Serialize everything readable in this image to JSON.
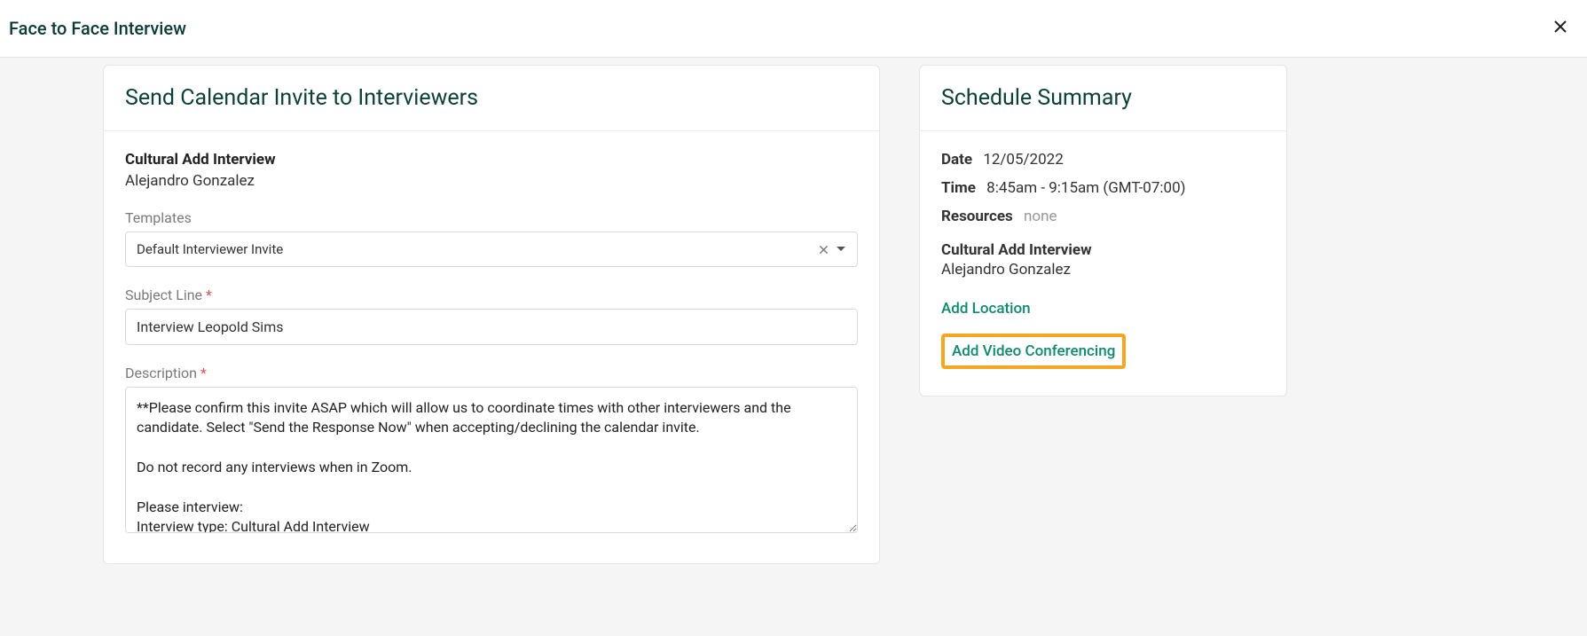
{
  "topbar": {
    "title": "Face to Face Interview"
  },
  "left": {
    "header": "Send Calendar Invite to Interviewers",
    "interview_name": "Cultural Add Interview",
    "candidate": "Alejandro Gonzalez",
    "templates_label": "Templates",
    "template_selected": "Default Interviewer Invite",
    "subject_label": "Subject Line",
    "subject_value": "Interview Leopold Sims",
    "description_label": "Description",
    "description_value": "**Please confirm this invite ASAP which will allow us to coordinate times with other interviewers and the candidate. Select \"Send the Response Now\" when accepting/declining the calendar invite.\n\nDo not record any interviews when in Zoom.\n\nPlease interview:\nInterview type: Cultural Add Interview"
  },
  "right": {
    "header": "Schedule Summary",
    "date_label": "Date",
    "date_value": "12/05/2022",
    "time_label": "Time",
    "time_value": "8:45am - 9:15am (GMT-07:00)",
    "resources_label": "Resources",
    "resources_value": "none",
    "interview_name": "Cultural Add Interview",
    "interviewer": "Alejandro Gonzalez",
    "add_location": "Add Location",
    "add_video": "Add Video Conferencing"
  }
}
